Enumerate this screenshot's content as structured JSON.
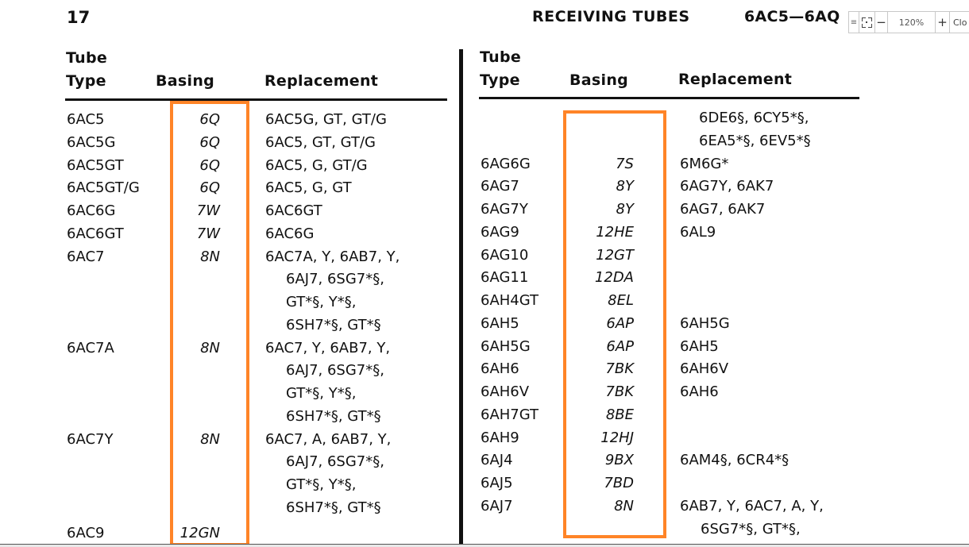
{
  "page": {
    "page_number": "17",
    "running_head": "RECEIVING  TUBES",
    "range_head": "6AC5—6AQ"
  },
  "toolbar": {
    "menu_icon": "≡",
    "zoom_minus": "−",
    "zoom_level": "120%",
    "zoom_plus": "+",
    "close_label": "Clo"
  },
  "table_headers": {
    "tube_line1": "Tube",
    "tube_line2": "Type",
    "basing": "Basing",
    "replacement": "Replacement"
  },
  "highlight_color": "#ff8427",
  "left_table": [
    {
      "type": "6AC5",
      "basing": "6Q",
      "replacement": [
        "6AC5G, GT, GT/G"
      ]
    },
    {
      "type": "6AC5G",
      "basing": "6Q",
      "replacement": [
        "6AC5, GT, GT/G"
      ]
    },
    {
      "type": "6AC5GT",
      "basing": "6Q",
      "replacement": [
        "6AC5, G, GT/G"
      ]
    },
    {
      "type": "6AC5GT/G",
      "basing": "6Q",
      "replacement": [
        "6AC5, G, GT"
      ]
    },
    {
      "type": "6AC6G",
      "basing": "7W",
      "replacement": [
        "6AC6GT"
      ]
    },
    {
      "type": "6AC6GT",
      "basing": "7W",
      "replacement": [
        "6AC6G"
      ]
    },
    {
      "type": "6AC7",
      "basing": "8N",
      "replacement": [
        "6AC7A, Y, 6AB7, Y,",
        "6AJ7, 6SG7*§,",
        "GT*§, Y*§,",
        "6SH7*§, GT*§"
      ]
    },
    {
      "type": "6AC7A",
      "basing": "8N",
      "replacement": [
        "6AC7, Y, 6AB7, Y,",
        "6AJ7, 6SG7*§,",
        "GT*§, Y*§,",
        "6SH7*§, GT*§"
      ]
    },
    {
      "type": "6AC7Y",
      "basing": "8N",
      "replacement": [
        "6AC7, A, 6AB7, Y,",
        "6AJ7, 6SG7*§,",
        "GT*§, Y*§,",
        "6SH7*§, GT*§"
      ]
    },
    {
      "type": "6AC9",
      "basing": "12GN",
      "replacement": []
    }
  ],
  "right_table": {
    "continuation": [
      "6DE6§, 6CY5*§,",
      "6EA5*§, 6EV5*§"
    ],
    "rows": [
      {
        "type": "6AG6G",
        "basing": "7S",
        "replacement": [
          "6M6G*"
        ]
      },
      {
        "type": "6AG7",
        "basing": "8Y",
        "replacement": [
          "6AG7Y, 6AK7"
        ]
      },
      {
        "type": "6AG7Y",
        "basing": "8Y",
        "replacement": [
          "6AG7, 6AK7"
        ]
      },
      {
        "type": "6AG9",
        "basing": "12HE",
        "replacement": [
          "6AL9"
        ]
      },
      {
        "type": "6AG10",
        "basing": "12GT",
        "replacement": []
      },
      {
        "type": "6AG11",
        "basing": "12DA",
        "replacement": []
      },
      {
        "type": "6AH4GT",
        "basing": "8EL",
        "replacement": []
      },
      {
        "type": "6AH5",
        "basing": "6AP",
        "replacement": [
          "6AH5G"
        ]
      },
      {
        "type": "6AH5G",
        "basing": "6AP",
        "replacement": [
          "6AH5"
        ]
      },
      {
        "type": "6AH6",
        "basing": "7BK",
        "replacement": [
          "6AH6V"
        ]
      },
      {
        "type": "6AH6V",
        "basing": "7BK",
        "replacement": [
          "6AH6"
        ]
      },
      {
        "type": "6AH7GT",
        "basing": "8BE",
        "replacement": []
      },
      {
        "type": "6AH9",
        "basing": "12HJ",
        "replacement": []
      },
      {
        "type": "6AJ4",
        "basing": "9BX",
        "replacement": [
          "6AM4§, 6CR4*§"
        ]
      },
      {
        "type": "6AJ5",
        "basing": "7BD",
        "replacement": []
      },
      {
        "type": "6AJ7",
        "basing": "8N",
        "replacement": [
          "6AB7, Y, 6AC7, A, Y,",
          "6SG7*§, GT*§,"
        ]
      }
    ]
  }
}
